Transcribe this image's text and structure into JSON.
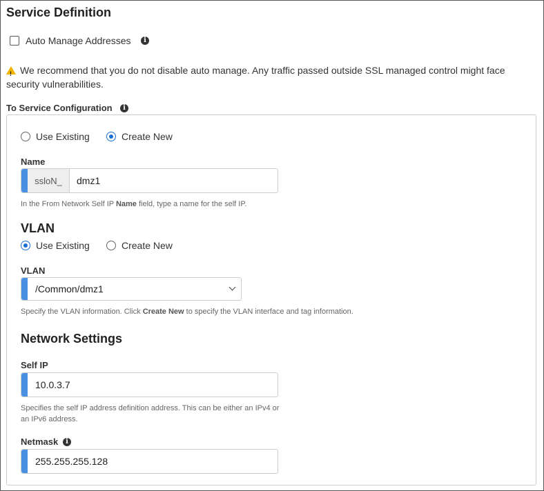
{
  "section": {
    "title": "Service Definition",
    "auto_manage_label": "Auto Manage Addresses",
    "warning_text": "We recommend that you do not disable auto manage. Any traffic passed outside SSL managed control might face security vulnerabilities.",
    "to_service_label": "To Service Configuration"
  },
  "config": {
    "use_existing_label": "Use Existing",
    "create_new_label": "Create New",
    "name_label": "Name",
    "name_prefix": "ssloN_",
    "name_value": "dmz1",
    "name_help_pre": "In the From Network Self IP ",
    "name_help_bold": "Name",
    "name_help_post": " field, type a name for the self IP."
  },
  "vlan": {
    "heading": "VLAN",
    "use_existing_label": "Use Existing",
    "create_new_label": "Create New",
    "field_label": "VLAN",
    "selected": "/Common/dmz1",
    "help_pre": "Specify the VLAN information. Click ",
    "help_bold": "Create New",
    "help_post": " to specify the VLAN interface and tag information."
  },
  "network": {
    "heading": "Network Settings",
    "self_ip_label": "Self IP",
    "self_ip_value": "10.0.3.7",
    "self_ip_help_1": "Specifies the self IP address definition address. This can be either an IPv4 or",
    "self_ip_help_2": "an IPv6 address.",
    "netmask_label": "Netmask",
    "netmask_value": "255.255.255.128"
  },
  "icons": {
    "info": "info-icon",
    "warning": "warning-icon",
    "chevron": "chevron-down-icon"
  },
  "colors": {
    "accent": "#4a90e2",
    "radio": "#1a6fd1",
    "warning": "#f0b400"
  }
}
